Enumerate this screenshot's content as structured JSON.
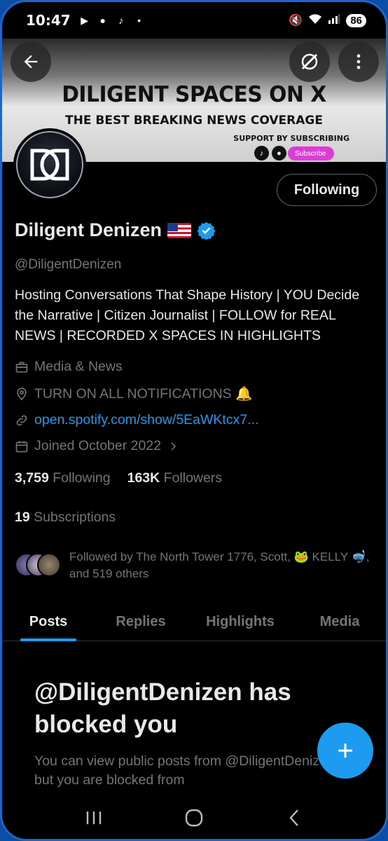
{
  "status_bar": {
    "time": "10:47",
    "battery": "86",
    "signal": "6"
  },
  "banner": {
    "title": "DILIGENT SPACES ON X",
    "subtitle": "THE BEST BREAKING NEWS COVERAGE",
    "support": "SUPPORT BY SUBSCRIBING",
    "subscribe": "Subscribe"
  },
  "profile": {
    "name": "Diligent Denizen",
    "handle": "@DiligentDenizen",
    "bio": "Hosting Conversations That Shape History | YOU Decide the Narrative | Citizen Journalist | FOLLOW for REAL NEWS | RECORDED X SPACES IN HIGHLIGHTS",
    "category": "Media & News",
    "location": "TURN ON ALL NOTIFICATIONS 🔔",
    "website": "open.spotify.com/show/5EaWKtcx7...",
    "joined": "Joined October 2022"
  },
  "follow_button": "Following",
  "counts": {
    "following_value": "3,759",
    "following_label": "Following",
    "followers_value": "163K",
    "followers_label": "Followers",
    "subscriptions_value": "19",
    "subscriptions_label": "Subscriptions"
  },
  "followed_by": "Followed by The North Tower 1776, Scott, 🐸 KELLY 🤿, and 519 others",
  "tabs": [
    "Posts",
    "Replies",
    "Highlights",
    "Media"
  ],
  "blocked": {
    "title": "@DiligentDenizen has blocked you",
    "text": "You can view public posts from @DiligentDenizen, but you are blocked from"
  },
  "colors": {
    "accent": "#1d9bf0",
    "background": "#000000",
    "muted": "#71767b"
  },
  "icons": [
    "back-arrow-icon",
    "x-off-icon",
    "more-vertical-icon",
    "verified-icon",
    "briefcase-icon",
    "location-pin-icon",
    "link-icon",
    "calendar-icon",
    "chevron-right-icon",
    "plus-icon"
  ]
}
